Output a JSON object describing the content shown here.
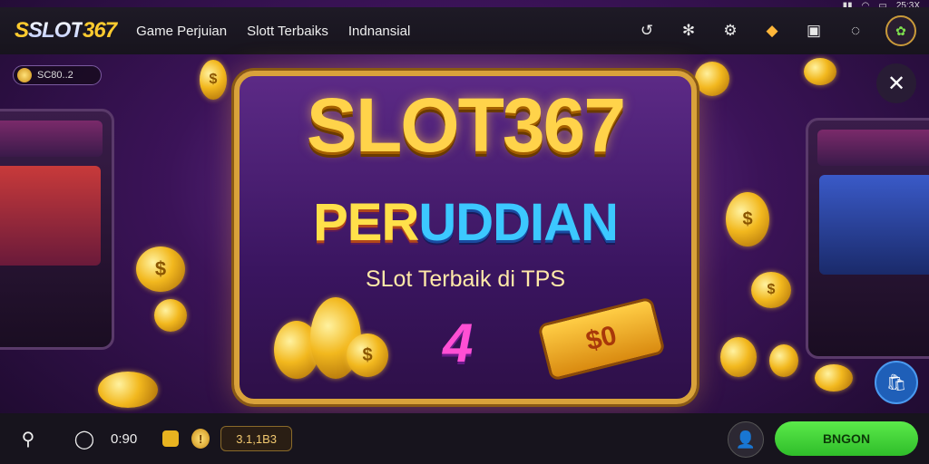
{
  "status_bar": {
    "time": "25:3X"
  },
  "header": {
    "logo_s": "S",
    "logo_text": "SLOT",
    "logo_num": "367",
    "nav": [
      "Game Perjuian",
      "Slott Terbaiks",
      "Indnansial"
    ]
  },
  "balance_pill": {
    "value": "SC80..2"
  },
  "banner": {
    "title": "SLOT367",
    "subtitle_a": "PER",
    "subtitle_b": "UDDIAN",
    "tagline": "SLot Terbaik di TPS",
    "number": "4",
    "sign_text": "$0"
  },
  "bottom_bar": {
    "count": "0:90",
    "value": "3.1,1B3",
    "go_label": "BNGON"
  },
  "colors": {
    "accent": "#ffd34a",
    "go": "#3bd435",
    "bag": "#1f5fb8"
  }
}
